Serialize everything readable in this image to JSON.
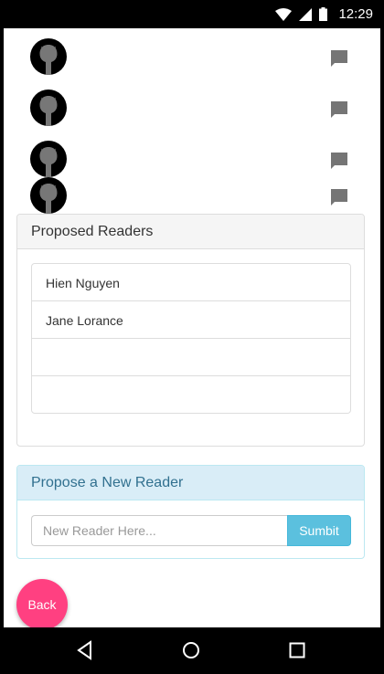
{
  "status_bar": {
    "time": "12:29"
  },
  "proposed_readers": {
    "title": "Proposed Readers",
    "readers": [
      "Hien Nguyen",
      "Jane Lorance",
      "",
      ""
    ]
  },
  "propose_new": {
    "title": "Propose a New Reader",
    "input_placeholder": "New Reader Here...",
    "input_value": "",
    "submit_label": "Sumbit"
  },
  "back_label": "Back",
  "colors": {
    "accent_pink": "#ff4081",
    "info_button": "#5bc0de",
    "info_heading_bg": "#d9edf7",
    "info_heading_text": "#31708f"
  },
  "icons": {
    "avatar": "github-octocat-icon",
    "comment": "comment-icon",
    "nav_back": "triangle-back-icon",
    "nav_home": "circle-home-icon",
    "nav_recents": "square-recents-icon"
  }
}
